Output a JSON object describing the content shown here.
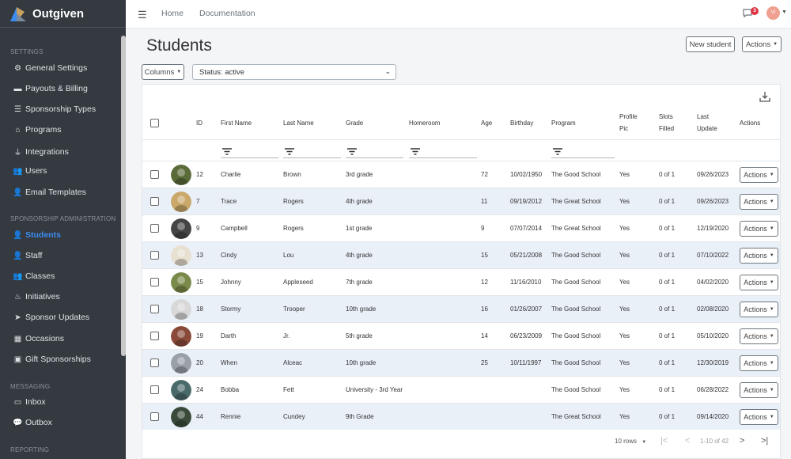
{
  "app": {
    "name": "Outgiven"
  },
  "sidebar": {
    "sections": [
      "Settings",
      "Sponsorship Administration",
      "Messaging",
      "Reporting"
    ],
    "items": [
      {
        "label": "General Settings",
        "icon": "gear-icon"
      },
      {
        "label": "Payouts & Billing",
        "icon": "money-icon"
      },
      {
        "label": "Sponsorship Types",
        "icon": "list-icon"
      },
      {
        "label": "Programs",
        "icon": "building-icon"
      },
      {
        "label": "Integrations",
        "icon": "plug-icon"
      },
      {
        "label": "Users",
        "icon": "users-icon"
      },
      {
        "label": "Email Templates",
        "icon": "user-envelope-icon"
      },
      {
        "label": "Students",
        "icon": "student-icon",
        "active": true
      },
      {
        "label": "Staff",
        "icon": "person-icon"
      },
      {
        "label": "Classes",
        "icon": "group-icon"
      },
      {
        "label": "Initiatives",
        "icon": "fire-icon"
      },
      {
        "label": "Sponsor Updates",
        "icon": "paper-plane-icon"
      },
      {
        "label": "Occasions",
        "icon": "calendar-icon"
      },
      {
        "label": "Gift Sponsorships",
        "icon": "gift-icon"
      },
      {
        "label": "Inbox",
        "icon": "inbox-icon"
      },
      {
        "label": "Outbox",
        "icon": "chat-icon"
      }
    ]
  },
  "topbar": {
    "links": [
      "Home",
      "Documentation"
    ],
    "notification_count": "3",
    "avatar_initials": "VI"
  },
  "page": {
    "title": "Students",
    "new_button": "New student",
    "actions_button": "Actions",
    "columns_button": "Columns",
    "status_filter": "Status: active"
  },
  "table": {
    "headers": {
      "id": "ID",
      "first": "First Name",
      "last": "Last Name",
      "grade": "Grade",
      "homeroom": "Homeroom",
      "age": "Age",
      "birthday": "Birthday",
      "program": "Program",
      "profile1": "Profile",
      "profile2": "Pic",
      "slots1": "Slots",
      "slots2": "Filled",
      "update1": "Last",
      "update2": "Update",
      "actions": "Actions"
    },
    "row_action_label": "Actions",
    "rows": [
      {
        "id": "12",
        "first": "Charlie",
        "last": "Brown",
        "grade": "3rd grade",
        "homeroom": "",
        "age": "72",
        "birthday": "10/02/1950",
        "program": "The Good School",
        "pic": "Yes",
        "slots": "0 of 1",
        "updated": "09/26/2023",
        "avatar_color": "#5a6b3a"
      },
      {
        "id": "7",
        "first": "Trace",
        "last": "Rogers",
        "grade": "4th grade",
        "homeroom": "",
        "age": "11",
        "birthday": "09/19/2012",
        "program": "The Great School",
        "pic": "Yes",
        "slots": "0 of 1",
        "updated": "09/26/2023",
        "avatar_color": "#c9a86a"
      },
      {
        "id": "9",
        "first": "Campbell",
        "last": "Rogers",
        "grade": "1st grade",
        "homeroom": "",
        "age": "9",
        "birthday": "07/07/2014",
        "program": "The Great School",
        "pic": "Yes",
        "slots": "0 of 1",
        "updated": "12/19/2020",
        "avatar_color": "#444444"
      },
      {
        "id": "13",
        "first": "Cindy",
        "last": "Lou",
        "grade": "4th grade",
        "homeroom": "",
        "age": "15",
        "birthday": "05/21/2008",
        "program": "The Good School",
        "pic": "Yes",
        "slots": "0 of 1",
        "updated": "07/10/2022",
        "avatar_color": "#e8e0d0"
      },
      {
        "id": "15",
        "first": "Johnny",
        "last": "Appleseed",
        "grade": "7th grade",
        "homeroom": "",
        "age": "12",
        "birthday": "11/16/2010",
        "program": "The Good School",
        "pic": "Yes",
        "slots": "0 of 1",
        "updated": "04/02/2020",
        "avatar_color": "#7a8a4a"
      },
      {
        "id": "18",
        "first": "Stormy",
        "last": "Trooper",
        "grade": "10th grade",
        "homeroom": "",
        "age": "16",
        "birthday": "01/26/2007",
        "program": "The Good School",
        "pic": "Yes",
        "slots": "0 of 1",
        "updated": "02/08/2020",
        "avatar_color": "#d8d8d8"
      },
      {
        "id": "19",
        "first": "Darth",
        "last": "Jr.",
        "grade": "5th grade",
        "homeroom": "",
        "age": "14",
        "birthday": "06/23/2009",
        "program": "The Good School",
        "pic": "Yes",
        "slots": "0 of 1",
        "updated": "05/10/2020",
        "avatar_color": "#8a4a3a"
      },
      {
        "id": "20",
        "first": "When",
        "last": "Alceac",
        "grade": "10th grade",
        "homeroom": "",
        "age": "25",
        "birthday": "10/11/1997",
        "program": "The Good School",
        "pic": "Yes",
        "slots": "0 of 1",
        "updated": "12/30/2019",
        "avatar_color": "#9aa0a8"
      },
      {
        "id": "24",
        "first": "Bobba",
        "last": "Fett",
        "grade": "University - 3rd Year",
        "homeroom": "",
        "age": "",
        "birthday": "",
        "program": "The Good School",
        "pic": "Yes",
        "slots": "0 of 1",
        "updated": "06/28/2022",
        "avatar_color": "#4a6a6a"
      },
      {
        "id": "44",
        "first": "Rennie",
        "last": "Cundey",
        "grade": "9th Grade",
        "homeroom": "",
        "age": "",
        "birthday": "",
        "program": "The Great School",
        "pic": "Yes",
        "slots": "0 of 1",
        "updated": "09/14/2020",
        "avatar_color": "#3a4a3a"
      }
    ]
  },
  "pagination": {
    "rows_per_page": "10 rows",
    "range": "1-10 of 42"
  },
  "colors": {
    "sidebar_bg": "#343a40",
    "active": "#3b8cf0",
    "row_alt": "#eaf0f8",
    "badge": "#dc3545"
  }
}
